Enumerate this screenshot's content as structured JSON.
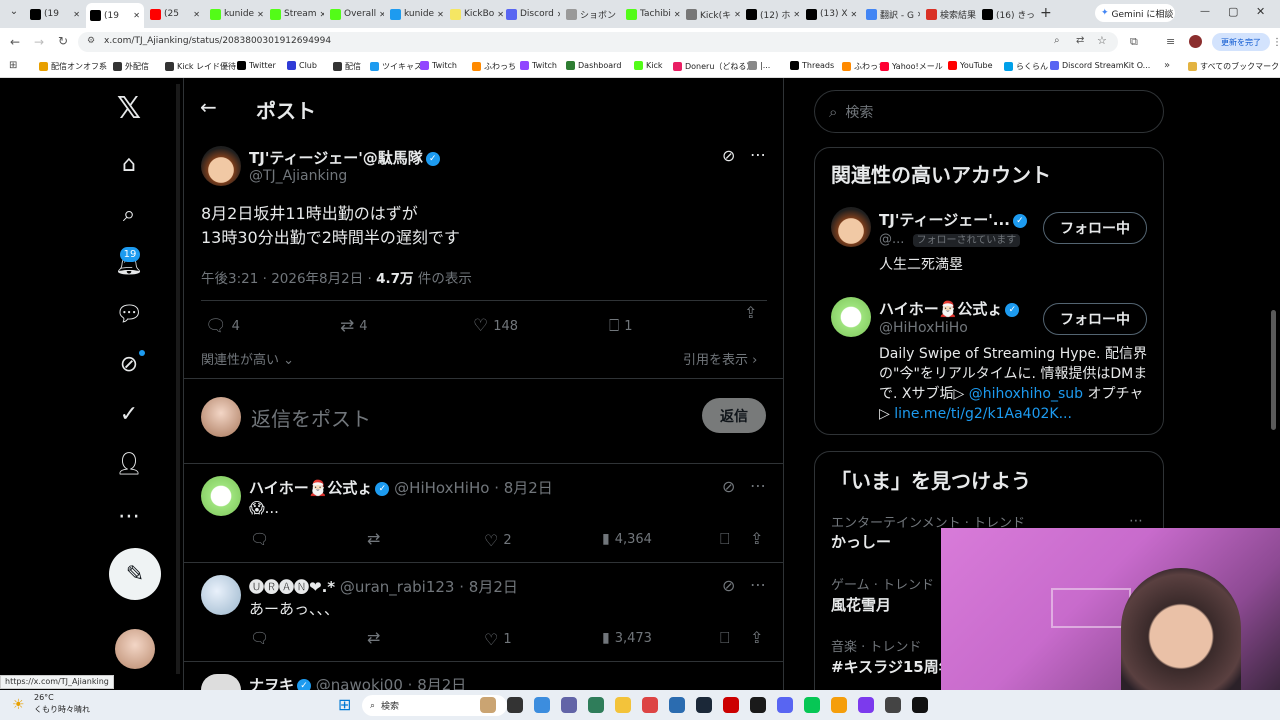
{
  "browser": {
    "tabs": [
      {
        "label": "(19",
        "color": "#000000"
      },
      {
        "label": "(19",
        "color": "#000000",
        "active": true
      },
      {
        "label": "(25",
        "color": "#ff0000"
      },
      {
        "label": "kunide",
        "color": "#53fc18"
      },
      {
        "label": "Stream",
        "color": "#53fc18"
      },
      {
        "label": "Overall",
        "color": "#53fc18"
      },
      {
        "label": "kunide",
        "color": "#1d9bf0"
      },
      {
        "label": "KickBo",
        "color": "#f5e663"
      },
      {
        "label": "Discord",
        "color": "#5865f2"
      },
      {
        "label": "ショボン",
        "color": "#999999"
      },
      {
        "label": "Tachibi",
        "color": "#53fc18"
      },
      {
        "label": "Kick(キ",
        "color": "#777777"
      },
      {
        "label": "(12) ホ",
        "color": "#000000"
      },
      {
        "label": "(13) X",
        "color": "#000000"
      },
      {
        "label": "翻訳 - G",
        "color": "#4285f4"
      },
      {
        "label": "検索結果",
        "color": "#d93025"
      },
      {
        "label": "(16) きっ",
        "color": "#000000"
      }
    ],
    "gemini_label": "Gemini に相談",
    "url": "x.com/TJ_Ajianking/status/2083800301912694994",
    "update_label": "更新を完了",
    "bookmarks": [
      {
        "label": "配信オンオフ系",
        "color": "#e8a000"
      },
      {
        "label": "外配信",
        "color": "#333333"
      },
      {
        "label": "Kick レイド優待",
        "color": "#333333"
      },
      {
        "label": "Twitter",
        "color": "#000000"
      },
      {
        "label": "Club",
        "color": "#2f3bd6"
      },
      {
        "label": "配信",
        "color": "#333333"
      },
      {
        "label": "ツイキャス",
        "color": "#1d9bf0"
      },
      {
        "label": "Twitch",
        "color": "#9146ff"
      },
      {
        "label": "ふわっち",
        "color": "#ff8a00"
      },
      {
        "label": "Twitch",
        "color": "#9146ff"
      },
      {
        "label": "Dashboard",
        "color": "#2e7d32"
      },
      {
        "label": "Kick",
        "color": "#53fc18"
      },
      {
        "label": "Doneru（どねる）",
        "color": "#e91e63"
      },
      {
        "label": "|...",
        "color": "#888888"
      },
      {
        "label": "Threads",
        "color": "#000000"
      },
      {
        "label": "ふわっち",
        "color": "#ff8a00"
      },
      {
        "label": "Yahoo!メール",
        "color": "#ff0033"
      },
      {
        "label": "YouTube",
        "color": "#ff0000"
      },
      {
        "label": "らくらん",
        "color": "#00a0e9"
      },
      {
        "label": "Discord StreamKit O...",
        "color": "#5865f2"
      }
    ],
    "all_bookmarks": "すべてのブックマーク",
    "status_url": "https://x.com/TJ_Ajianking"
  },
  "x": {
    "notif_badge": "19",
    "header_title": "ポスト",
    "post": {
      "display_name": "TJ'ティージェー'@駄馬隊",
      "handle": "@TJ_Ajianking",
      "line1": "8月2日坂井11時出勤のはずが",
      "line2": "13時30分出勤で2時間半の遅刻です",
      "time": "午後3:21 · 2026年8月2日 · ",
      "views": "4.7万",
      "views_label": " 件の表示",
      "replies": "4",
      "reposts": "4",
      "likes": "148",
      "bookmarks": "1",
      "relevance": "関連性が高い",
      "quotes": "引用を表示"
    },
    "reply_box": {
      "placeholder": "返信をポスト",
      "button": "返信"
    },
    "replies": [
      {
        "name": "ハイホー🎅🏻公式ょ",
        "handle": "@HiHoxHiHo",
        "date": "· 8月2日",
        "text": "😱...",
        "reply_count": "",
        "repost_count": "",
        "like_count": "2",
        "view_count": "4,364"
      },
      {
        "name": "🅤🅡🅐🅝❤︎.*",
        "handle": "@uran_rabi123",
        "date": "· 8月2日",
        "text": "あーあっ、、、",
        "reply_count": "",
        "repost_count": "",
        "like_count": "1",
        "view_count": "3,473"
      },
      {
        "name": "ナヲキ",
        "handle": "@nawoki00",
        "date": "· 8月2日"
      }
    ],
    "search_placeholder": "検索",
    "related": {
      "title": "関連性の高いアカウント",
      "accounts": [
        {
          "name": "TJ'ティージェー'...",
          "handle": "@...",
          "follows_you": "フォローされています",
          "bio": "人生二死満塁",
          "button": "フォロー中"
        },
        {
          "name": "ハイホー🎅🏻公式ょ",
          "handle": "@HiHoxHiHo",
          "bio_a": "Daily Swipe of Streaming Hype. 配信界の\"今\"をリアルタイムに. 情報提供はDMまで. Xサブ垢▷ ",
          "bio_link": "@hihoxhiho_sub",
          "bio_b": " オプチャ▷ ",
          "bio_link2": "line.me/ti/g2/k1Aa402K...",
          "button": "フォロー中"
        }
      ]
    },
    "trends": {
      "title": "「いま」を見つけよう",
      "items": [
        {
          "category": "エンターテインメント · トレンド",
          "name": "かっしー"
        },
        {
          "category": "ゲーム · トレンド",
          "name": "風花雪月"
        },
        {
          "category": "音楽 · トレンド",
          "name": "#キスラジ15周年"
        }
      ]
    }
  },
  "taskbar": {
    "weather_temp": "26°C",
    "weather_text": "くもり時々晴れ",
    "search": "検索"
  }
}
